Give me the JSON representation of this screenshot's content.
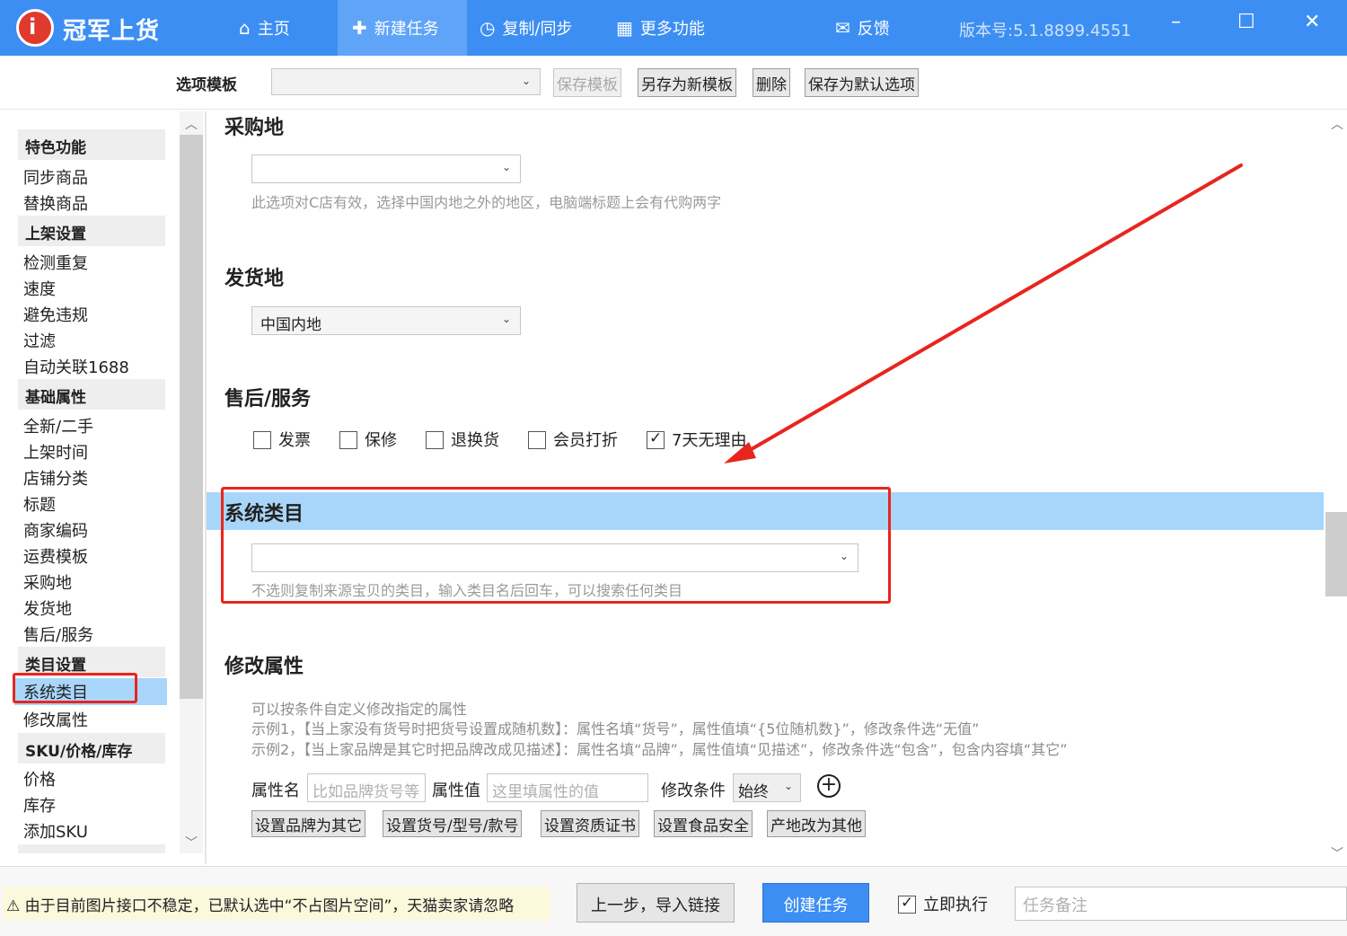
{
  "titlebar": {
    "app_title": "冠军上货",
    "nav": [
      {
        "label": "主页",
        "icon": "home-icon"
      },
      {
        "label": "新建任务",
        "icon": "new-task-icon"
      },
      {
        "label": "复制/同步",
        "icon": "clock-icon"
      },
      {
        "label": "更多功能",
        "icon": "grid-icon"
      }
    ],
    "feedback": "反馈",
    "version": "版本号:5.1.8899.4551"
  },
  "toolbar": {
    "template_label": "选项模板",
    "template_value": "",
    "save_template": "保存模板",
    "save_as_new": "另存为新模板",
    "delete": "删除",
    "save_default": "保存为默认选项"
  },
  "sidebar": {
    "groups": [
      "特色功能",
      "上架设置",
      "基础属性",
      "类目设置",
      "SKU/价格/库存"
    ],
    "items": {
      "feature": [
        "同步商品",
        "替换商品"
      ],
      "listing": [
        "检测重复",
        "速度",
        "避免违规",
        "过滤",
        "自动关联1688"
      ],
      "basic": [
        "全新/二手",
        "上架时间",
        "店铺分类",
        "标题",
        "商家编码",
        "运费模板",
        "采购地",
        "发货地",
        "售后/服务"
      ],
      "category": [
        "系统类目",
        "修改属性"
      ],
      "sku": [
        "价格",
        "库存",
        "添加SKU"
      ]
    }
  },
  "main": {
    "purchase": {
      "title": "采购地",
      "value": "",
      "hint": "此选项对C店有效，选择中国内地之外的地区，电脑端标题上会有代购两字"
    },
    "ship_from": {
      "title": "发货地",
      "value": "中国内地"
    },
    "after_sales": {
      "title": "售后/服务",
      "options": [
        {
          "label": "发票",
          "checked": false
        },
        {
          "label": "保修",
          "checked": false
        },
        {
          "label": "退换货",
          "checked": false
        },
        {
          "label": "会员打折",
          "checked": false
        },
        {
          "label": "7天无理由",
          "checked": true
        }
      ]
    },
    "system_category": {
      "title": "系统类目",
      "value": "",
      "hint": "不选则复制来源宝贝的类目，输入类目名后回车，可以搜索任何类目"
    },
    "modify_attrs": {
      "title": "修改属性",
      "desc1": "可以按条件自定义修改指定的属性",
      "desc2": "示例1，【当上家没有货号时把货号设置成随机数】：属性名填“货号”，属性值填“{5位随机数}”，修改条件选“无值”",
      "desc3": "示例2，【当上家品牌是其它时把品牌改成见描述】：属性名填“品牌”，属性值填“见描述”，修改条件选“包含”，包含内容填“其它”",
      "attr_name_label": "属性名",
      "attr_name_placeholder": "比如品牌货号等",
      "attr_value_label": "属性值",
      "attr_value_placeholder": "这里填属性的值",
      "condition_label": "修改条件",
      "condition_value": "始终",
      "quick_buttons": [
        "设置品牌为其它",
        "设置货号/型号/款号",
        "设置资质证书",
        "设置食品安全",
        "产地改为其他"
      ]
    }
  },
  "footer": {
    "warning": "由于目前图片接口不稳定，已默认选中“不占图片空间”，天猫卖家请忽略",
    "prev_button": "上一步，导入链接",
    "create_button": "创建任务",
    "execute_now": "立即执行",
    "memo_placeholder": "任务备注"
  },
  "colors": {
    "accent": "#3d8ef2",
    "highlight": "#a8d6fa",
    "annotation": "#e8251f"
  }
}
